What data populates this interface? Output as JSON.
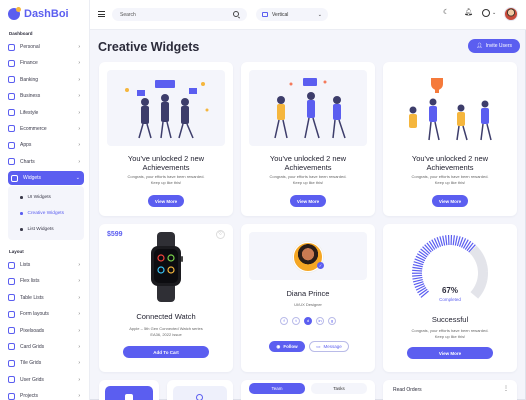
{
  "app": {
    "name": "DashBoi"
  },
  "sidebar": {
    "dashboard_label": "Dashboard",
    "items": [
      {
        "label": "Personal",
        "icon": "user-icon"
      },
      {
        "label": "Finance",
        "icon": "finance-icon"
      },
      {
        "label": "Banking",
        "icon": "bank-icon"
      },
      {
        "label": "Business",
        "icon": "briefcase-icon"
      },
      {
        "label": "Lifestyle",
        "icon": "lifestyle-icon"
      },
      {
        "label": "Ecommerce",
        "icon": "cart-icon"
      },
      {
        "label": "Apps",
        "icon": "apps-icon"
      },
      {
        "label": "Charts",
        "icon": "chart-icon"
      },
      {
        "label": "Widgets",
        "icon": "widgets-icon"
      }
    ],
    "widgets_sub": [
      "UI Widgets",
      "Creative Widgets",
      "List Widgets"
    ],
    "layout_label": "Layout",
    "layout_items": [
      {
        "label": "Lists"
      },
      {
        "label": "Flex lists"
      },
      {
        "label": "Table Lists"
      },
      {
        "label": "Form layouts"
      },
      {
        "label": "Pixelsoads"
      },
      {
        "label": "Card Grids"
      },
      {
        "label": "Tile Grids"
      },
      {
        "label": "User Grids"
      },
      {
        "label": "Projects"
      }
    ]
  },
  "topbar": {
    "search_placeholder": "Search",
    "layout_value": "Vertical"
  },
  "page": {
    "title": "Creative Widgets",
    "invite_label": "Invite Users"
  },
  "achievements": [
    {
      "title_line1": "You've unlocked 2 new",
      "title_line2": "Achievements",
      "text_line1": "Congrats, your efforts have been rewarded.",
      "text_line2": "Keep up like this!",
      "button": "View More"
    },
    {
      "title_line1": "You've unlocked 2 new",
      "title_line2": "Achievements",
      "text_line1": "Congrats, your efforts have been rewarded.",
      "text_line2": "Keep up like this!",
      "button": "View More"
    },
    {
      "title_line1": "You've unlocked 2 new",
      "title_line2": "Achievements",
      "text_line1": "Congrats, your efforts have been rewarded.",
      "text_line2": "Keep up like this!",
      "button": "View More"
    }
  ],
  "product": {
    "price": "$599",
    "title": "Connected Watch",
    "desc_line1": "Apple – 5th Gen Connected Watch series",
    "desc_line2": "EA36, 2022 issue",
    "button": "Add To Cart"
  },
  "profile": {
    "name": "Diana Prince",
    "role": "UI/UX Designer",
    "follow": "Follow",
    "message": "Message",
    "socials": [
      "f",
      "t",
      "d",
      "in",
      "g"
    ]
  },
  "progress": {
    "percent_label": "67%",
    "value": 0.67,
    "status": "Completed",
    "title": "Successful",
    "text_line1": "Congrats, your efforts have been rewarded.",
    "text_line2": "Keep up like this!",
    "button": "View More"
  },
  "bottom": {
    "tab_active": "Team",
    "tab_other": "Tasks",
    "orders_title": "Read Orders"
  },
  "colors": {
    "accent": "#5b5ef0",
    "accent_light": "#b9bbe8"
  }
}
